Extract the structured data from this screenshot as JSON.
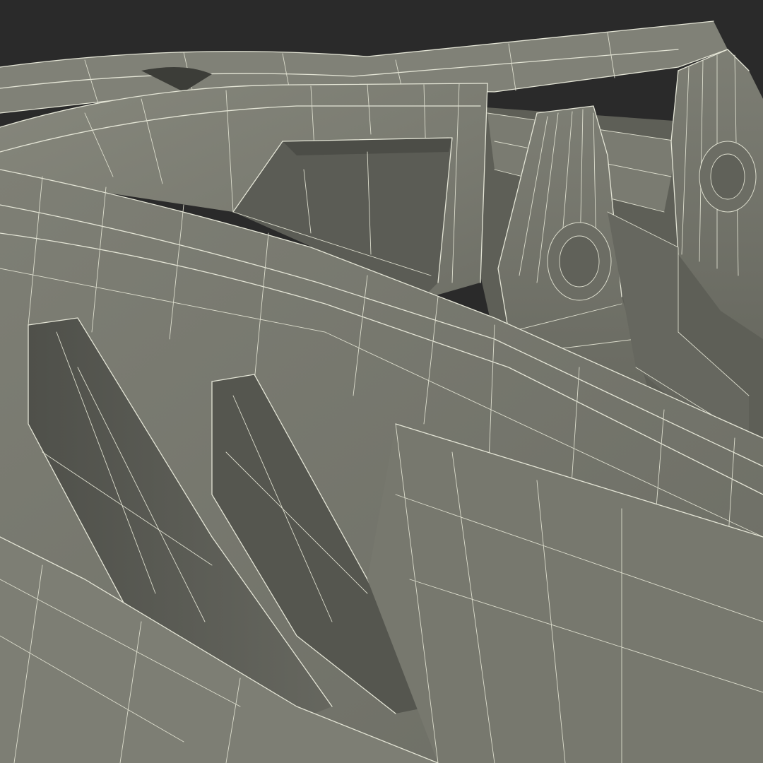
{
  "scene": {
    "subject": "car-body-wireframe-render",
    "background_color": "#2a2a2a",
    "surface_color": "#7b7c72",
    "surface_shadow_color": "#55564f",
    "surface_highlight_color": "#8a8b80",
    "wire_color": "#e4e5d6"
  }
}
